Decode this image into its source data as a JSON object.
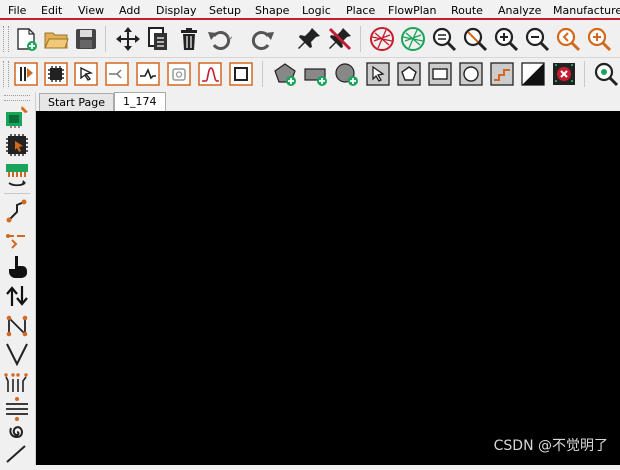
{
  "menubar": {
    "items": [
      "File",
      "Edit",
      "View",
      "Add",
      "Display",
      "Setup",
      "Shape",
      "Logic",
      "Place",
      "FlowPlan",
      "Route",
      "Analyze",
      "Manufacture"
    ]
  },
  "toolbar1": {
    "buttons": [
      "new-design",
      "open",
      "save",
      "move",
      "copy",
      "delete",
      "undo",
      "redo",
      "fix",
      "unfix",
      "unrats-all",
      "rats-all",
      "zoom-fit",
      "zoom-points",
      "zoom-in",
      "zoom-out",
      "zoom-previous",
      "zoom-world"
    ]
  },
  "toolbar2": {
    "buttons": [
      "place-manual",
      "place-component",
      "pick",
      "connect",
      "add-connect",
      "slide",
      "delay-tune",
      "shape-compose",
      "add-pad",
      "add-line",
      "add-circle",
      "select",
      "pentagon",
      "rectangle",
      "circle",
      "step",
      "stack",
      "ratt",
      "zoom-search"
    ]
  },
  "left_toolbar": {
    "buttons": [
      "place-manual-left",
      "place-component-left",
      "edit-pins",
      "connect-left",
      "slide-left",
      "hand",
      "flip",
      "pin-swap",
      "route-v",
      "fanout",
      "bus",
      "spiral",
      "phase"
    ]
  },
  "tabs": [
    {
      "label": "Start Page",
      "active": false
    },
    {
      "label": "1_174",
      "active": true
    }
  ],
  "canvas": {
    "background": "#000000"
  },
  "watermark": "CSDN @不觉明了",
  "colors": {
    "accent": "#c51d2f",
    "orange": "#d2691e",
    "green": "#1aa35a"
  }
}
